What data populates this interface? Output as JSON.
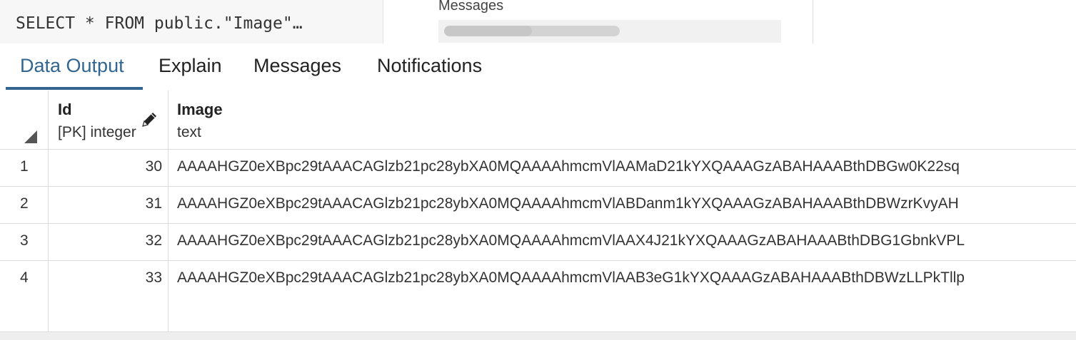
{
  "query": {
    "text": "SELECT * FROM public.\"Image\"…"
  },
  "messages_panel": {
    "title": "Messages",
    "progress": 0.5
  },
  "tabs": [
    {
      "label": "Data Output",
      "active": true
    },
    {
      "label": "Explain",
      "active": false
    },
    {
      "label": "Messages",
      "active": false
    },
    {
      "label": "Notifications",
      "active": false
    }
  ],
  "grid": {
    "columns": [
      {
        "name": "Id",
        "type": "[PK] integer",
        "editable_icon": "pencil-icon"
      },
      {
        "name": "Image",
        "type": "text"
      }
    ],
    "rows": [
      {
        "row_number": "1",
        "id": "30",
        "image": "AAAAHGZ0eXBpc29tAAACAGlzb21pc28ybXA0MQAAAAhmcmVlAAMaD21kYXQAAAGzABAHAAABthDBGw0K22sq"
      },
      {
        "row_number": "2",
        "id": "31",
        "image": "AAAAHGZ0eXBpc29tAAACAGlzb21pc28ybXA0MQAAAAhmcmVlABDanm1kYXQAAAGzABAHAAABthDBWzrKvyAH"
      },
      {
        "row_number": "3",
        "id": "32",
        "image": "AAAAHGZ0eXBpc29tAAACAGlzb21pc28ybXA0MQAAAAhmcmVlAAX4J21kYXQAAAGzABAHAAABthDBG1GbnkVPL"
      },
      {
        "row_number": "4",
        "id": "33",
        "image": "AAAAHGZ0eXBpc29tAAACAGlzb21pc28ybXA0MQAAAAhmcmVlAAB3eG1kYXQAAAGzABAHAAABthDBWzLLPkTllp"
      }
    ]
  },
  "colors": {
    "accent": "#326690",
    "grid_line": "#dadada"
  }
}
